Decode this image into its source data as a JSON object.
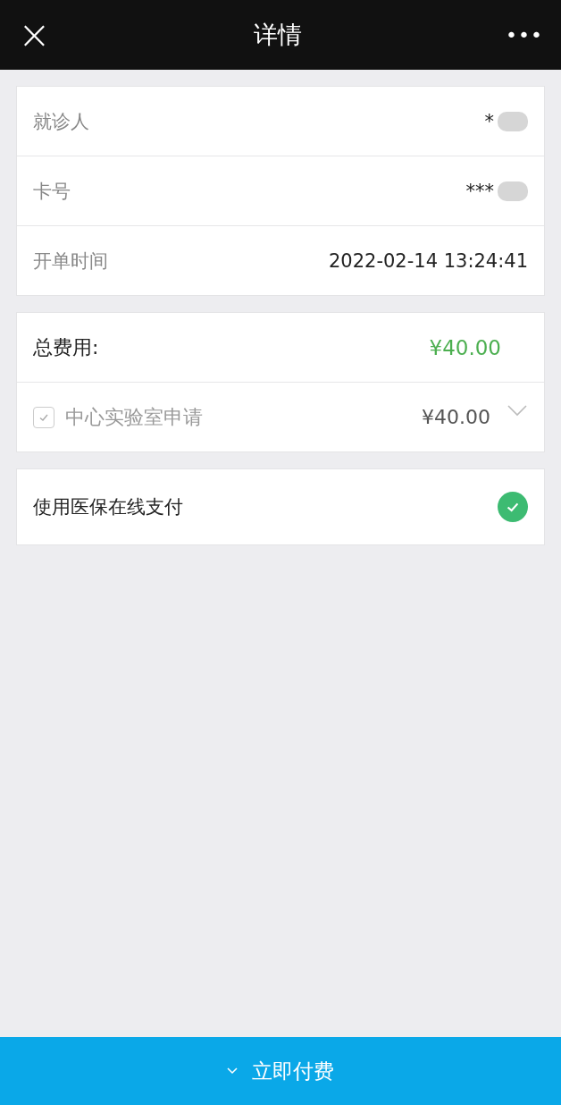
{
  "header": {
    "close": "×",
    "title": "详情",
    "menu": "•••"
  },
  "info": [
    {
      "label": "就诊人",
      "value": "*",
      "redacted": true
    },
    {
      "label": "卡号",
      "value": "***",
      "redacted": true
    },
    {
      "label": "开单时间",
      "value": "2022-02-14 13:24:41",
      "redacted": false
    }
  ],
  "fees": {
    "label": "总费用:",
    "total": "¥40.00",
    "items": [
      {
        "name": "中心实验室申请",
        "amount": "¥40.00",
        "checked": true,
        "expanded": false
      }
    ]
  },
  "insurance": {
    "label": "使用医保在线支付",
    "checked": true
  },
  "pay_button": "立即付费"
}
